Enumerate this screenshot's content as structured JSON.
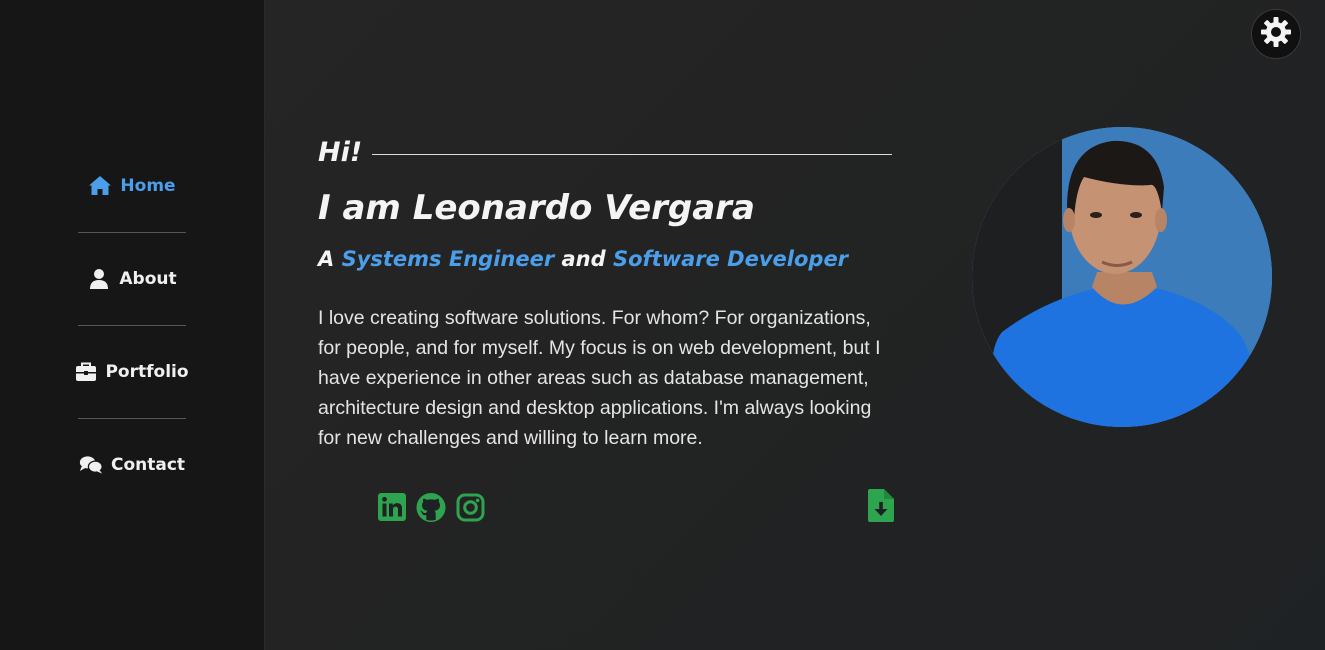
{
  "sidebar": {
    "items": [
      {
        "label": "Home",
        "icon": "home-icon",
        "active": true
      },
      {
        "label": "About",
        "icon": "user-icon",
        "active": false
      },
      {
        "label": "Portfolio",
        "icon": "briefcase-icon",
        "active": false
      },
      {
        "label": "Contact",
        "icon": "comments-icon",
        "active": false
      }
    ]
  },
  "header": {
    "settings_icon": "gear-icon"
  },
  "hero": {
    "greeting": "Hi!",
    "name": "I am Leonardo Vergara",
    "role": {
      "prefix": "A",
      "first": "Systems Engineer",
      "joiner": "and",
      "second": "Software Developer"
    },
    "bio": "I love creating software solutions. For whom? For organizations, for people, and for myself. My focus is on web development, but I have experience in other areas such as database management, architecture design and desktop applications. I'm always looking for new challenges and willing to learn more.",
    "social": [
      "linkedin-icon",
      "github-icon",
      "instagram-icon"
    ],
    "download_icon": "file-download-icon"
  },
  "colors": {
    "accent": "#4a9eea",
    "social": "#2ea44f",
    "sidebar_bg": "#161616",
    "main_bg": "#242424"
  }
}
